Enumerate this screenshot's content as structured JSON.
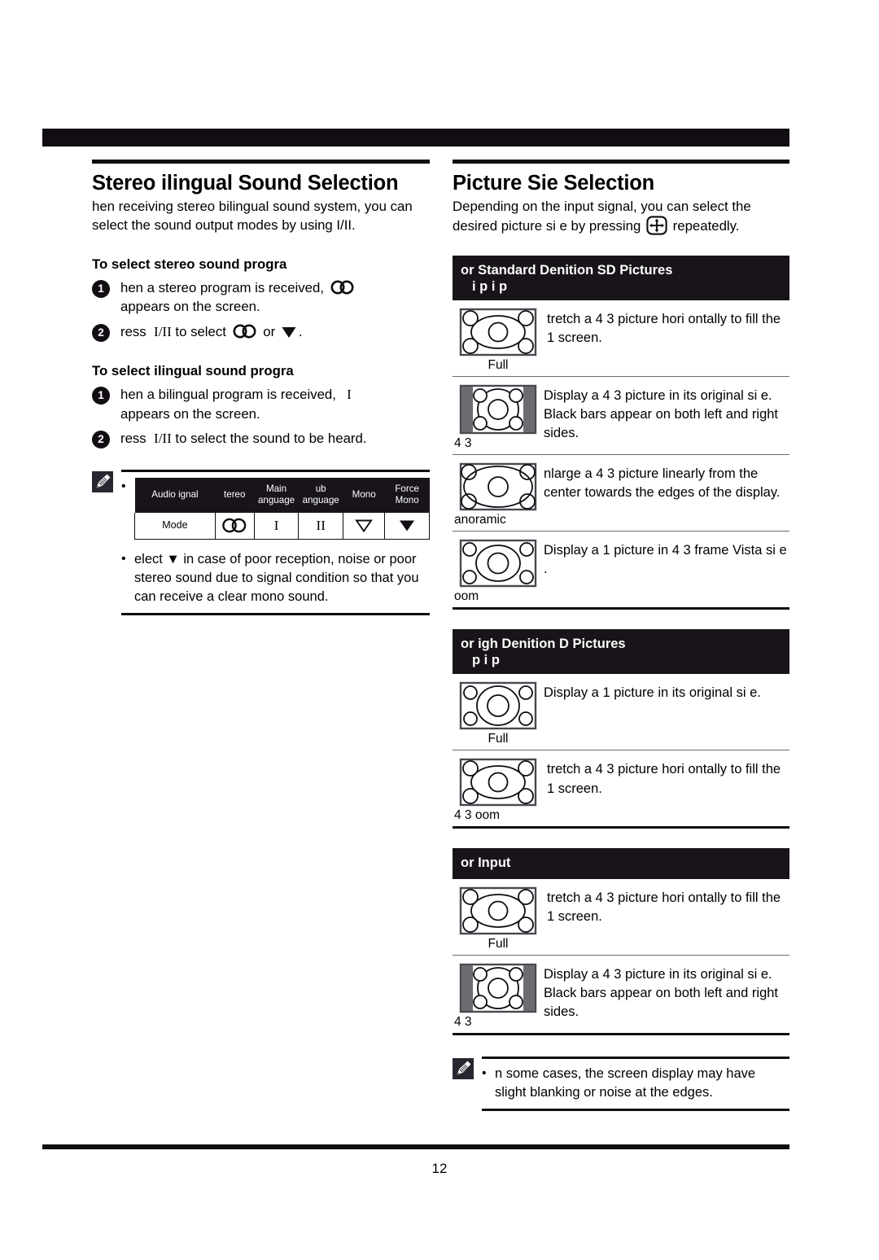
{
  "page": {
    "folio": "12"
  },
  "left": {
    "title": "Stereo  ilingual Sound Selection",
    "intro": " hen receiving stereo bilingual sound system, you can select the sound output modes by using I/II.",
    "stereo_heading": "To select stereo sound progra",
    "stereo_steps": [
      {
        "num": "1",
        "text_before": " hen a stereo program is received,",
        "icon": "stereo-icon",
        "text_after": "appears on the screen."
      },
      {
        "num": "2",
        "text_before": " ress  I/II to select",
        "icon": "stereo-icon",
        "mid": "or",
        "icon2": "force-mono-icon",
        "text_after": "."
      }
    ],
    "bilingual_heading": "To select  ilingual sound progra",
    "bilingual_steps": [
      {
        "num": "1",
        "text_before": " hen a bilingual program is received,",
        "icon": "roman-one",
        "text_after": "appears on the screen."
      },
      {
        "num": "2",
        "text_before": " ress  I/II to select the sound to be heard.",
        "icon": "",
        "text_after": ""
      }
    ],
    "note": {
      "icon": "pencil-note-icon",
      "table": {
        "headers": [
          "Audio  ignal",
          " tereo",
          "Main  anguage",
          " ub  anguage",
          "Mono",
          "Force Mono"
        ],
        "headers_lines": [
          [
            "Audio  ignal"
          ],
          [
            " tereo"
          ],
          [
            "Main",
            " anguage"
          ],
          [
            " ub",
            " anguage"
          ],
          [
            "Mono"
          ],
          [
            "Force",
            "Mono"
          ]
        ],
        "row_label": "Mode",
        "row_symbols": [
          "stereo-icon",
          "roman-one",
          "roman-two",
          "mono-icon",
          "force-mono-icon"
        ]
      },
      "tip": " elect  ▼  in case of poor reception, noise or poor stereo sound due to signal condition so that you can receive a clear mono sound."
    }
  },
  "right": {
    "title": "Picture  Sie Selection",
    "intro_before": "Depending on the input signal, you can select the desired picture si e by pressing",
    "intro_icon": "picture-size-button-icon",
    "intro_after": "repeatedly.",
    "sections": [
      {
        "heading_line1": " or Standard Denition  SD  Pictures",
        "heading_line2": "i     p    i    p",
        "rows": [
          {
            "icon": "full-wide-icon",
            "caption": "Full",
            "desc": " tretch a 4 3 picture hori ontally to fill the 1   screen."
          },
          {
            "icon": "four-three-bars-icon",
            "caption": "4 3",
            "desc": "Display a 4 3 picture in its original si e.  Black bars appear on both left and right sides."
          },
          {
            "icon": "panoramic-icon",
            "caption": " anoramic",
            "desc": " nlarge a 4 3 picture linearly from the center towards the edges of the display."
          },
          {
            "icon": "zoom-icon",
            "caption": " oom",
            "desc": "Display a 1    picture in 4 3 frame  Vista si e ."
          }
        ]
      },
      {
        "heading_line1": " or  igh Denition   D  Pictures",
        "heading_line2": "p     i      p",
        "rows": [
          {
            "icon": "hd-full-icon",
            "caption": "Full",
            "desc": "Display a 1    picture in its original si e."
          },
          {
            "icon": "full-wide-icon",
            "caption": "4 3  oom",
            "desc": " tretch a 4 3 picture hori ontally to fill the 1   screen."
          }
        ]
      },
      {
        "heading_line1": " or   Input",
        "heading_line2": "",
        "rows": [
          {
            "icon": "full-wide-icon",
            "caption": "Full",
            "desc": " tretch a 4 3 picture hori ontally to fill the 1   screen."
          },
          {
            "icon": "four-three-bars-icon",
            "caption": "4 3",
            "desc": "Display a 4 3 picture in its original si e.  Black bars appear on both left and right sides."
          }
        ]
      }
    ],
    "note": {
      "icon": "pencil-note-icon",
      "text": " n some cases, the screen display may have slight blanking or noise at the edges."
    }
  },
  "colors": {
    "ink": "#110d12",
    "header_bar": "#181419",
    "rule_light": "#6e6a72",
    "bar_fill": "#6d6a70"
  }
}
